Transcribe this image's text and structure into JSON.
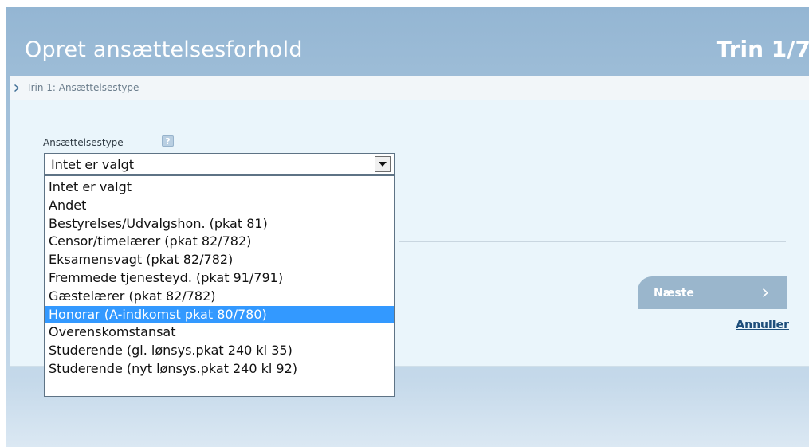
{
  "header": {
    "title": "Opret ansættelsesforhold",
    "step": "Trin 1/7"
  },
  "breadcrumb": {
    "text": "Trin 1: Ansættelsestype"
  },
  "form": {
    "label": "Ansættelsestype",
    "help_icon": "?",
    "select_value": "Intet er valgt",
    "options": [
      "Intet er valgt",
      "Andet",
      "Bestyrelses/Udvalgshon. (pkat 81)",
      "Censor/timelærer (pkat 82/782)",
      "Eksamensvagt (pkat 82/782)",
      "Fremmede tjenesteyd. (pkat 91/791)",
      "Gæstelærer (pkat 82/782)",
      "Honorar (A-indkomst pkat 80/780)",
      "Overenskomstansat",
      "Studerende (gl. lønsys.pkat 240 kl 35)",
      "Studerende (nyt lønsys.pkat 240 kl 92)"
    ],
    "highlighted_option": "Honorar (A-indkomst pkat 80/780)"
  },
  "actions": {
    "next_label": "Næste",
    "cancel_label": "Annuller"
  },
  "colors": {
    "header_bg": "#94b6d3",
    "content_bg": "#eaf5fb",
    "highlight": "#3399ff",
    "link": "#1d4e7b"
  },
  "icons": {
    "breadcrumb": "chevron-right-icon",
    "help": "help-icon",
    "select": "dropdown-arrow-icon",
    "next": "chevron-right-icon"
  }
}
